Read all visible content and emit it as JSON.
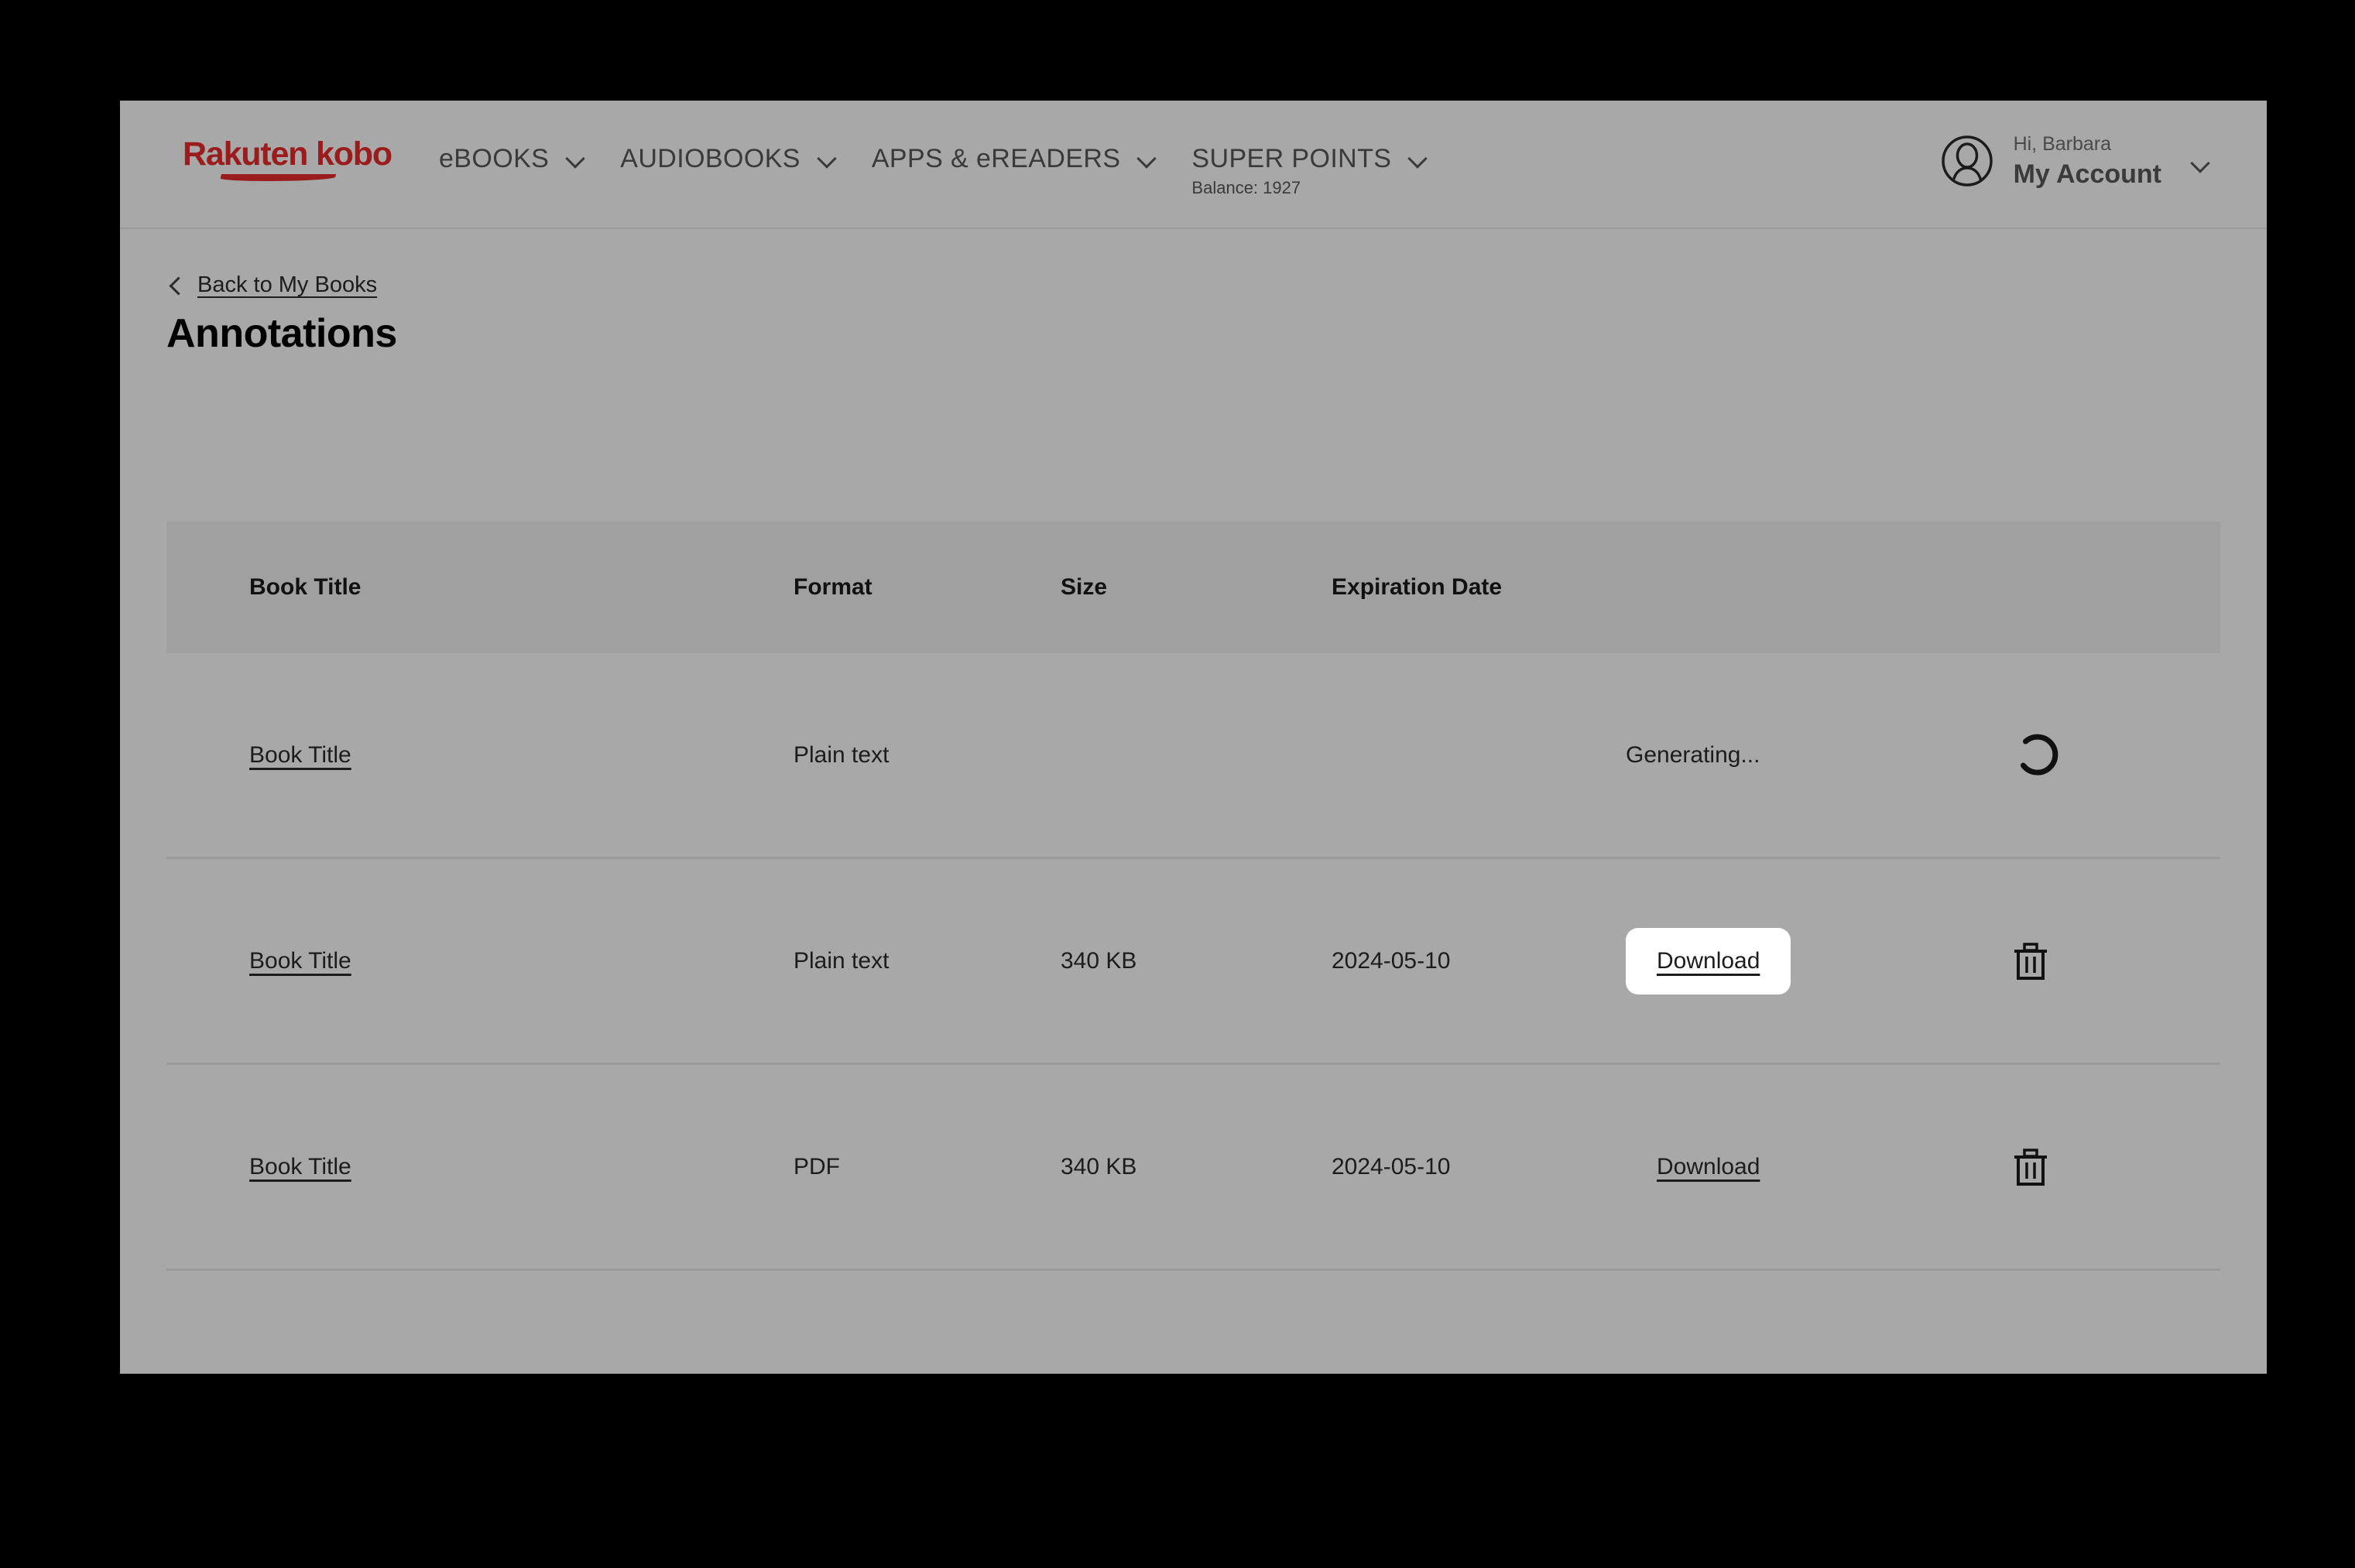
{
  "header": {
    "brand": {
      "name": "Rakuten kobo",
      "color": "#9b1c1c",
      "icon": "rakuten-kobo-logo"
    },
    "nav": [
      {
        "label": "eBOOKS",
        "icon": "chevron-down-icon"
      },
      {
        "label": "AUDIOBOOKS",
        "icon": "chevron-down-icon"
      },
      {
        "label": "APPS & eREADERS",
        "icon": "chevron-down-icon"
      },
      {
        "label": "SUPER POINTS",
        "sub": "Balance: 1927",
        "icon": "chevron-down-icon"
      }
    ],
    "account": {
      "avatar_icon": "user-avatar-icon",
      "greeting": "Hi, Barbara",
      "label": "My Account",
      "chevron_icon": "chevron-down-icon"
    }
  },
  "breadcrumb": {
    "back_label": "Back to My Books",
    "back_icon": "chevron-left-icon"
  },
  "page": {
    "title": "Annotations"
  },
  "table": {
    "columns": [
      "Book Title",
      "Format",
      "Size",
      "Expiration Date"
    ],
    "rows": [
      {
        "title": "Book Title",
        "format": "Plain text",
        "size": "",
        "expiration": "",
        "status": "Generating...",
        "action": "",
        "spinner": true,
        "delete": false,
        "highlighted": false
      },
      {
        "title": "Book Title",
        "format": "Plain text",
        "size": "340 KB",
        "expiration": "2024-05-10",
        "status": "",
        "action": "Download",
        "spinner": false,
        "delete": true,
        "highlighted": true
      },
      {
        "title": "Book Title",
        "format": "PDF",
        "size": "340 KB",
        "expiration": "2024-05-10",
        "status": "",
        "action": "Download",
        "spinner": false,
        "delete": true,
        "highlighted": false
      }
    ],
    "delete_icon": "trash-icon",
    "spinner_icon": "loading-spinner-icon"
  },
  "colors": {
    "page_background": "#a8a8a8",
    "table_header_background": "#a0a0a0",
    "brand_red": "#9b1c1c",
    "highlight_background": "#ffffff",
    "divider": "#9b9b9b"
  }
}
